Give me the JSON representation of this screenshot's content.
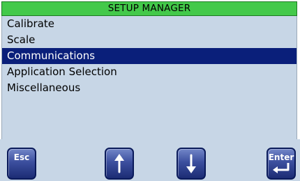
{
  "title": "SETUP MANAGER",
  "menu": {
    "items": [
      {
        "label": "Calibrate"
      },
      {
        "label": "Scale"
      },
      {
        "label": "Communications"
      },
      {
        "label": "Application Selection"
      },
      {
        "label": "Miscellaneous"
      }
    ],
    "selected": "Communications"
  },
  "buttons": {
    "esc_label": "Esc",
    "up_icon": "arrow-up-icon",
    "down_icon": "arrow-down-icon",
    "enter_label": "Enter",
    "enter_icon": "return-arrow-icon"
  },
  "colors": {
    "title_bg": "#43c94a",
    "panel_bg": "#c7d6e6",
    "selection_bg": "#0a1f7a",
    "button_bg": "#3c4f9e"
  }
}
